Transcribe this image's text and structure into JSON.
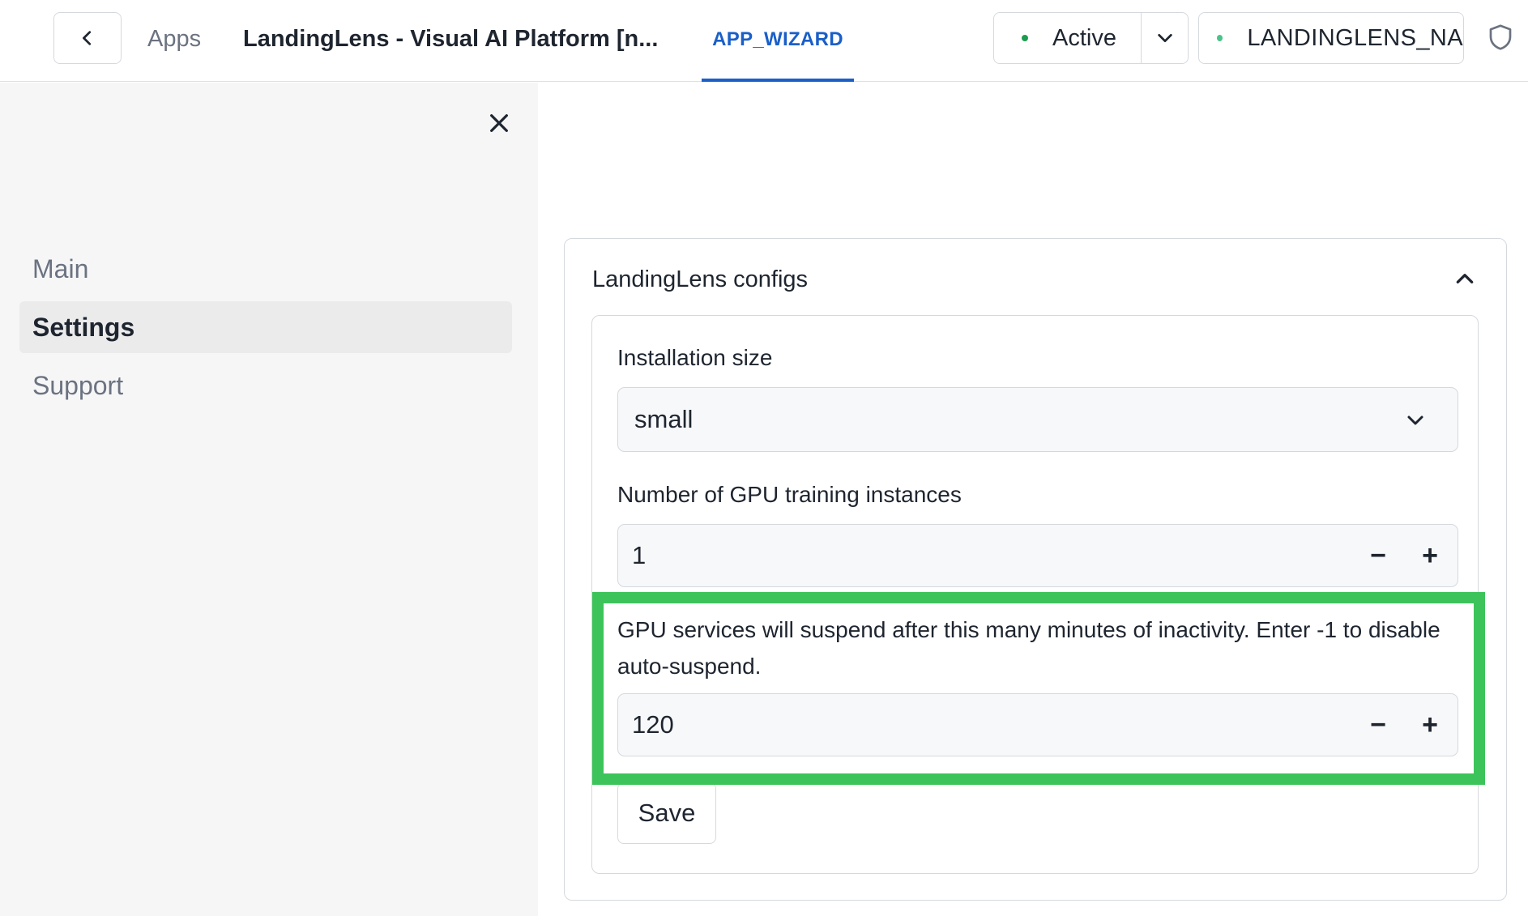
{
  "header": {
    "breadcrumb_root": "Apps",
    "app_title": "LandingLens - Visual AI Platform [n...",
    "active_tab": "APP_WIZARD",
    "status_label": "Active",
    "environment_label": "LANDINGLENS_NA"
  },
  "sidebar": {
    "items": [
      {
        "label": "Main",
        "active": false
      },
      {
        "label": "Settings",
        "active": true
      },
      {
        "label": "Support",
        "active": false
      }
    ]
  },
  "config": {
    "section_title": "LandingLens configs",
    "installation_size": {
      "label": "Installation size",
      "value": "small"
    },
    "gpu_instances": {
      "label": "Number of GPU training instances",
      "value": "1"
    },
    "auto_suspend": {
      "label": "GPU services will suspend after this many minutes of inactivity. Enter -1 to disable auto-suspend.",
      "value": "120"
    },
    "save_label": "Save"
  },
  "colors": {
    "accent": "#1a5fc8",
    "status_active": "#1d9c4f",
    "highlight": "#3cc45a"
  },
  "icons": {
    "back": "chevron-left-icon",
    "status_dropdown": "chevron-down-icon",
    "shield": "shield-icon",
    "close": "close-icon",
    "collapse": "chevron-up-icon",
    "select": "chevron-down-icon"
  }
}
